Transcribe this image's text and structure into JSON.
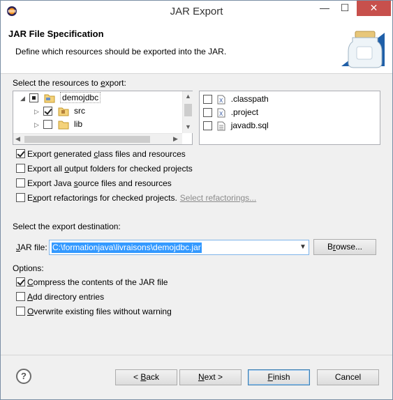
{
  "window": {
    "title": "JAR Export",
    "minimize_icon": "minimize-icon",
    "maximize_icon": "maximize-icon",
    "close_icon": "close-icon"
  },
  "header": {
    "title": "JAR File Specification",
    "description": "Define which resources should be exported into the JAR.",
    "image": "jar-icon"
  },
  "resources": {
    "label_prefix": "Select the resources to ",
    "label_underlined": "e",
    "label_suffix": "xport:",
    "tree": [
      {
        "name": "demojdbc",
        "state": "partial",
        "expanded": true,
        "icon": "project-folder-icon"
      },
      {
        "name": "src",
        "state": "checked",
        "expanded": false,
        "icon": "package-folder-icon"
      },
      {
        "name": "lib",
        "state": "unchecked",
        "expanded": false,
        "icon": "folder-icon"
      }
    ],
    "files": [
      {
        "name": ".classpath",
        "checked": false,
        "icon": "xml-file-icon"
      },
      {
        "name": ".project",
        "checked": false,
        "icon": "xml-file-icon"
      },
      {
        "name": "javadb.sql",
        "checked": false,
        "icon": "text-file-icon"
      }
    ]
  },
  "options_top": [
    {
      "pre": "Export generated ",
      "u": "c",
      "post": "lass files and resources",
      "checked": true
    },
    {
      "pre": "Export all ",
      "u": "o",
      "post": "utput folders for checked projects",
      "checked": false
    },
    {
      "pre": "Export Java ",
      "u": "s",
      "post": "ource files and resources",
      "checked": false
    },
    {
      "pre": "E",
      "u": "x",
      "post": "port refactorings for checked projects.",
      "checked": false
    }
  ],
  "select_refactorings_link": "Select refactorings...",
  "destination": {
    "label": "Select the export destination:",
    "jar_label_u": "J",
    "jar_label_rest": "AR file:",
    "jar_value": "C:\\formationjava\\livraisons\\demojdbc.jar",
    "browse_pre": "B",
    "browse_u": "r",
    "browse_post": "owse..."
  },
  "options": {
    "label": "Options:",
    "items": [
      {
        "pre": "",
        "u": "C",
        "post": "ompress the contents of the JAR file",
        "checked": true
      },
      {
        "pre": "",
        "u": "A",
        "post": "dd directory entries",
        "checked": false
      },
      {
        "pre": "",
        "u": "O",
        "post": "verwrite existing files without warning",
        "checked": false
      }
    ]
  },
  "footer": {
    "help_icon": "help-icon",
    "back_pre": "< ",
    "back_u": "B",
    "back_post": "ack",
    "next_u": "N",
    "next_post": "ext >",
    "finish_u": "F",
    "finish_post": "inish",
    "cancel": "Cancel"
  }
}
